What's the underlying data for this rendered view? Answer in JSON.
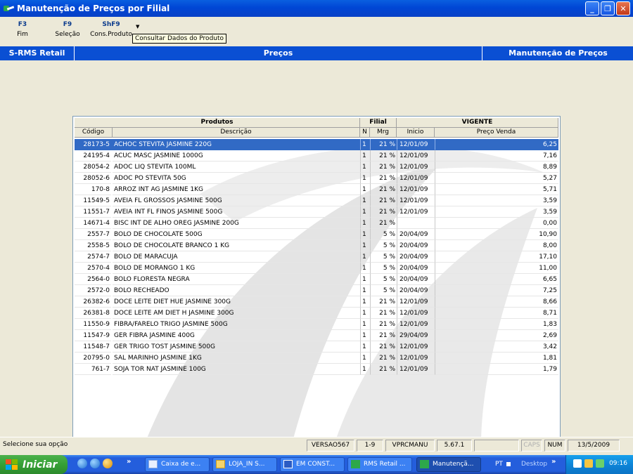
{
  "window": {
    "title": "Manutenção de Preços por Filial",
    "min_label": "_",
    "max_label": "❐",
    "close_label": "✕"
  },
  "toolbar": {
    "items": [
      {
        "key": "F3",
        "label": "Fim"
      },
      {
        "key": "F9",
        "label": "Seleção"
      },
      {
        "key": "ShF9",
        "label": "Cons.Produto"
      }
    ],
    "dropdown_glyph": "▼",
    "tooltip": "Consultar Dados do Produto"
  },
  "band": {
    "left": "S-RMS Retail",
    "center": "Preços",
    "right": "Manutenção de Preços"
  },
  "grid": {
    "group_headers": {
      "produtos": "Produtos",
      "filial": "Filial",
      "vigente": "VIGENTE"
    },
    "columns": {
      "codigo": "Código",
      "descricao": "Descrição",
      "n": "N",
      "mrg": "Mrg",
      "inicio": "Inicio",
      "preco": "Preço Venda"
    },
    "rows": [
      {
        "codigo": "28173-5",
        "descricao": "ACHOC STEVITA JASMINE 220G",
        "n": "1",
        "mrg": "21 %",
        "inicio": "12/01/09",
        "preco": "6,25",
        "selected": true
      },
      {
        "codigo": "24195-4",
        "descricao": "ACUC MASC JASMINE 1000G",
        "n": "1",
        "mrg": "21 %",
        "inicio": "12/01/09",
        "preco": "7,16"
      },
      {
        "codigo": "28054-2",
        "descricao": "ADOC LIQ STEVITA 100ML",
        "n": "1",
        "mrg": "21 %",
        "inicio": "12/01/09",
        "preco": "8,89"
      },
      {
        "codigo": "28052-6",
        "descricao": "ADOC PO STEVITA 50G",
        "n": "1",
        "mrg": "21 %",
        "inicio": "12/01/09",
        "preco": "5,27"
      },
      {
        "codigo": "170-8",
        "descricao": "ARROZ INT AG JASMINE 1KG",
        "n": "1",
        "mrg": "21 %",
        "inicio": "12/01/09",
        "preco": "5,71"
      },
      {
        "codigo": "11549-5",
        "descricao": "AVEIA FL GROSSOS JASMINE 500G",
        "n": "1",
        "mrg": "21 %",
        "inicio": "12/01/09",
        "preco": "3,59"
      },
      {
        "codigo": "11551-7",
        "descricao": "AVEIA INT FL FINOS JASMINE 500G",
        "n": "1",
        "mrg": "21 %",
        "inicio": "12/01/09",
        "preco": "3,59"
      },
      {
        "codigo": "14671-4",
        "descricao": "BISC INT DE ALHO OREG JASMINE 200G",
        "n": "1",
        "mrg": "21 %",
        "inicio": "",
        "preco": "0,00"
      },
      {
        "codigo": "2557-7",
        "descricao": "BOLO DE CHOCOLATE 500G",
        "n": "1",
        "mrg": "5 %",
        "inicio": "20/04/09",
        "preco": "10,90"
      },
      {
        "codigo": "2558-5",
        "descricao": "BOLO DE CHOCOLATE BRANCO 1 KG",
        "n": "1",
        "mrg": "5 %",
        "inicio": "20/04/09",
        "preco": "8,00"
      },
      {
        "codigo": "2574-7",
        "descricao": "BOLO DE MARACUJA",
        "n": "1",
        "mrg": "5 %",
        "inicio": "20/04/09",
        "preco": "17,10"
      },
      {
        "codigo": "2570-4",
        "descricao": "BOLO DE MORANGO 1 KG",
        "n": "1",
        "mrg": "5 %",
        "inicio": "20/04/09",
        "preco": "11,00"
      },
      {
        "codigo": "2564-0",
        "descricao": "BOLO FLORESTA NEGRA",
        "n": "1",
        "mrg": "5 %",
        "inicio": "20/04/09",
        "preco": "6,65"
      },
      {
        "codigo": "2572-0",
        "descricao": "BOLO RECHEADO",
        "n": "1",
        "mrg": "5 %",
        "inicio": "20/04/09",
        "preco": "7,25"
      },
      {
        "codigo": "26382-6",
        "descricao": "DOCE  LEITE DIET HUE JASMINE 300G",
        "n": "1",
        "mrg": "21 %",
        "inicio": "12/01/09",
        "preco": "8,66"
      },
      {
        "codigo": "26381-8",
        "descricao": "DOCE LEITE AM DIET H JASMINE 300G",
        "n": "1",
        "mrg": "21 %",
        "inicio": "12/01/09",
        "preco": "8,71"
      },
      {
        "codigo": "11550-9",
        "descricao": "FIBRA/FARELO TRIGO JASMINE 500G",
        "n": "1",
        "mrg": "21 %",
        "inicio": "12/01/09",
        "preco": "1,83"
      },
      {
        "codigo": "11547-9",
        "descricao": "GER FIBRA JASMINE 400G",
        "n": "1",
        "mrg": "21 %",
        "inicio": "29/04/09",
        "preco": "2,69"
      },
      {
        "codigo": "11548-7",
        "descricao": "GER TRIGO TOST JASMINE 500G",
        "n": "1",
        "mrg": "21 %",
        "inicio": "12/01/09",
        "preco": "3,42"
      },
      {
        "codigo": "20795-0",
        "descricao": "SAL MARINHO JASMINE 1KG",
        "n": "1",
        "mrg": "21 %",
        "inicio": "12/01/09",
        "preco": "1,81"
      },
      {
        "codigo": "761-7",
        "descricao": "SOJA TOR NAT JASMINE 100G",
        "n": "1",
        "mrg": "21 %",
        "inicio": "12/01/09",
        "preco": "1,79"
      }
    ]
  },
  "status": {
    "message": "Selecione sua opção",
    "version": "VERSAO567",
    "range": "1-9",
    "program": "VPRCMANU",
    "build": "5.67.1",
    "blank": "",
    "caps": "CAPS",
    "num": "NUM",
    "date": "13/5/2009"
  },
  "taskbar": {
    "start_label": "Iniciar",
    "chevron": "»",
    "tasks": [
      {
        "label": "Caixa de e...",
        "icon": "mail-icon"
      },
      {
        "label": "LOJA_IN S...",
        "icon": "folder-icon"
      },
      {
        "label": "EM CONST...",
        "icon": "word-icon"
      },
      {
        "label": "RMS Retail ...",
        "icon": "rms-icon"
      },
      {
        "label": "Manutençã...",
        "icon": "rms-icon",
        "active": true
      }
    ],
    "lang": "PT",
    "desktop": "Desktop",
    "clock": "09:16"
  },
  "colors": {
    "titlebar": "#0046D5",
    "band": "#0A4FD3",
    "selection": "#316AC5",
    "window_bg": "#ECE9D8"
  }
}
